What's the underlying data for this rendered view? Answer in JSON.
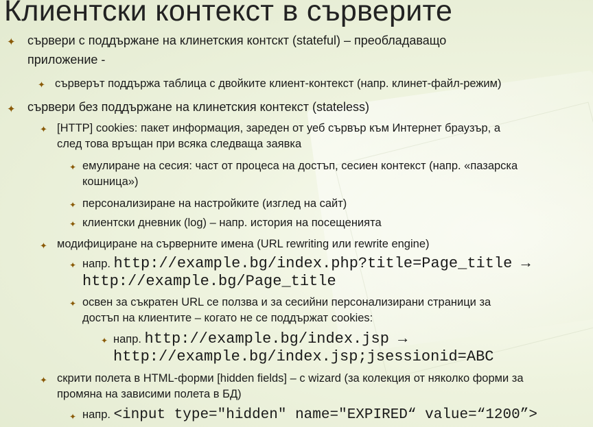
{
  "title": "Клиентски контекст в сърверите",
  "l1a": "сървери с поддържане на клинетския контскт (stateful) – преобладаващо",
  "l1b": "приложение -",
  "l2": "сърверът поддържа таблица с двойките клиент-контекст (напр. клинет-файл-режим)",
  "l3": "сървери без поддържане на клинетския контекст (stateless)",
  "l4a": "[HTTP] cookies: пакет информация, зареден от уеб сървър към Интернет браузър, а",
  "l4b": "след това връщан при всяка следваща заявка",
  "l5a": "емулиране на сесия: част от процеса на достъп, сесиен контекст (напр. «пазарска",
  "l5b": "кошница»)",
  "l6": "персонализиране на настройките (изглед на сайт)",
  "l7": "клиентски дневник (log) – напр. история на посещенията",
  "l8": "модифициране на сърверните имена (URL rewriting или rewrite engine)",
  "l9pre": "напр.",
  "l9code": "http://example.bg/index.php?title=Page_title →",
  "l9b": "http://example.bg/Page_title",
  "l10a": "освен за съкратен URL се ползва и за сесийни персонализирани страници за",
  "l10b": "достъп на клиентите – когато не се поддържат cookies:",
  "l11pre": "напр.",
  "l11code": "http://example.bg/index.jsp →",
  "l11b": "http://example.bg/index.jsp;jsessionid=ABC",
  "l12a": "скрити полета в HTML-форми [hidden fields] – с wizard (за колекция от няколко форми за",
  "l12b": "промяна на зависими полета в БД)",
  "l13pre": "напр.",
  "l13code": "<input type=\"hidden\" name=\"EXPIRED“ value=“1200”>",
  "bullet": "✦"
}
